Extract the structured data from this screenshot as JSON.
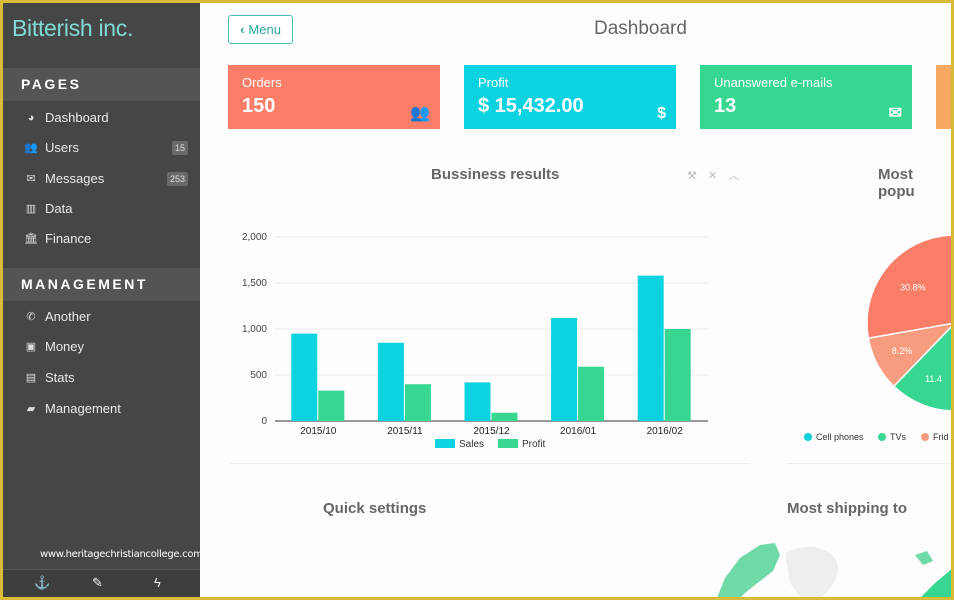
{
  "sidebar": {
    "brand": "Bitterish inc.",
    "sections": [
      {
        "title": "PAGES",
        "items": [
          {
            "label": "Dashboard",
            "icon": "dashboard-icon",
            "glyph": "◕"
          },
          {
            "label": "Users",
            "icon": "users-icon",
            "glyph": "👥",
            "badge": "15"
          },
          {
            "label": "Messages",
            "icon": "envelope-icon",
            "glyph": "✉",
            "badge": "253"
          },
          {
            "label": "Data",
            "icon": "bar-chart-icon",
            "glyph": "▥"
          },
          {
            "label": "Finance",
            "icon": "bank-icon",
            "glyph": "🏛"
          }
        ]
      },
      {
        "title": "MANAGEMENT",
        "items": [
          {
            "label": "Another",
            "icon": "phone-icon",
            "glyph": "✆"
          },
          {
            "label": "Money",
            "icon": "money-icon",
            "glyph": "▣"
          },
          {
            "label": "Stats",
            "icon": "briefcase-icon",
            "glyph": "▤"
          },
          {
            "label": "Management",
            "icon": "book-icon",
            "glyph": "▰"
          }
        ]
      }
    ],
    "watermark": "www.heritagechristiancollege.com",
    "footer_icons": [
      {
        "name": "anchor-icon",
        "glyph": "⚓"
      },
      {
        "name": "no-edit-icon",
        "glyph": "✎"
      },
      {
        "name": "bolt-icon",
        "glyph": "ϟ"
      }
    ]
  },
  "header": {
    "menu_button": "Menu",
    "menu_chevron": "‹",
    "title": "Dashboard"
  },
  "stats": [
    {
      "label": "Orders",
      "value": "150",
      "icon": "users-icon",
      "glyph": "👥",
      "color": "#fa7d68"
    },
    {
      "label": "Profit",
      "value": "$ 15,432.00",
      "icon": "dollar-icon",
      "glyph": "$",
      "color": "#0dd2e0"
    },
    {
      "label": "Unanswered e-mails",
      "value": "13",
      "icon": "envelope-icon",
      "glyph": "✉",
      "color": "#37d691"
    },
    {
      "label": "",
      "value": "",
      "icon": "",
      "glyph": "",
      "color": "#f9a95f"
    }
  ],
  "panels": {
    "business_results": {
      "title": "Bussiness results",
      "tools": [
        "wrench-icon",
        "close-icon",
        "chevron-up-icon"
      ],
      "tool_glyphs": [
        "⚒",
        "✕",
        "︿"
      ]
    },
    "most_popular": {
      "title": "Most popu"
    },
    "quick_settings": {
      "title": "Quick settings"
    },
    "most_shipping": {
      "title": "Most shipping to"
    }
  },
  "chart_data": [
    {
      "type": "bar",
      "title": "Bussiness results",
      "categories": [
        "2015/10",
        "2015/11",
        "2015/12",
        "2016/01",
        "2016/02"
      ],
      "series": [
        {
          "name": "Sales",
          "color": "#0dd2e0",
          "values": [
            950,
            850,
            420,
            1120,
            1580
          ]
        },
        {
          "name": "Profit",
          "color": "#37d691",
          "values": [
            330,
            400,
            90,
            590,
            1000
          ]
        }
      ],
      "yticks": [
        "0",
        "500",
        "1,000",
        "1,500",
        "2,000"
      ],
      "ylim": [
        0,
        2000
      ],
      "xlabel": "",
      "ylabel": "",
      "grid": true,
      "legend": "bottom"
    },
    {
      "type": "pie",
      "title": "Most popu",
      "slices": [
        {
          "label": "Fridges",
          "value": 30.8,
          "display": "30.8%",
          "color": "#fa7d68"
        },
        {
          "label": "Fridges (lite)",
          "value": 8.2,
          "display": "8.2%",
          "color": "#f79c7e"
        },
        {
          "label": "TVs",
          "value": 11.4,
          "display": "11.4",
          "color": "#37d691"
        }
      ],
      "legend": [
        {
          "label": "Cell phones",
          "color": "#0dd2e0"
        },
        {
          "label": "TVs",
          "color": "#37d691"
        },
        {
          "label": "Frid",
          "color": "#f79c7e"
        }
      ]
    }
  ]
}
